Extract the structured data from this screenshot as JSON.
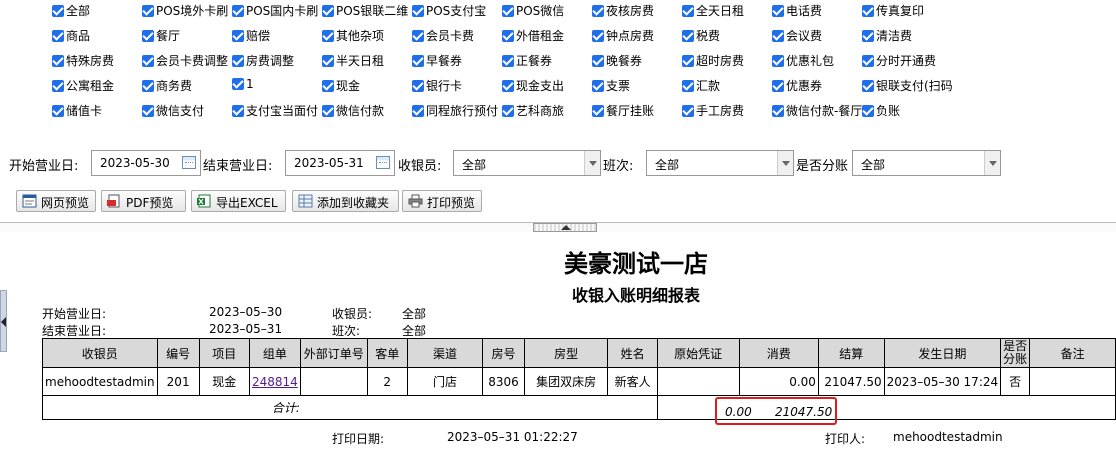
{
  "filters": {
    "checkbox_rows": [
      [
        "全部",
        "POS境外卡刷",
        "POS国内卡刷",
        "POS银联二维",
        "POS支付宝",
        "POS微信",
        "夜核房费",
        "全天日租",
        "电话费",
        "传真复印"
      ],
      [
        "商品",
        "餐厅",
        "赔偿",
        "其他杂项",
        "会员卡费",
        "外借租金",
        "钟点房费",
        "税费",
        "会议费",
        "清洁费"
      ],
      [
        "特殊房费",
        "会员卡费调整",
        "房费调整",
        "半天日租",
        "早餐券",
        "正餐券",
        "晚餐券",
        "超时房费",
        "优惠礼包",
        "分时开通费"
      ],
      [
        "公寓租金",
        "商务费",
        "1",
        "现金",
        "银行卡",
        "现金支出",
        "支票",
        "汇款",
        "优惠券",
        "银联支付(扫码"
      ],
      [
        "储值卡",
        "微信支付",
        "支付宝当面付",
        "微信付款",
        "同程旅行预付",
        "艺科商旅",
        "餐厅挂账",
        "手工房费",
        "微信付款-餐厅",
        "负账"
      ]
    ],
    "start_label": "开始营业日:",
    "start_value": "2023-05-30",
    "end_label": "结束营业日:",
    "end_value": "2023-05-31",
    "cashier_label": "收银员:",
    "cashier_value": "全部",
    "shift_label": "班次:",
    "shift_value": "全部",
    "split_label": "是否分账",
    "split_value": "全部"
  },
  "toolbar": {
    "web_preview": "网页预览",
    "pdf_preview": "PDF预览",
    "export_excel": "导出EXCEL",
    "add_favorite": "添加到收藏夹",
    "print_preview": "打印预览"
  },
  "report": {
    "title": "美豪测试一店",
    "subtitle": "收银入账明细报表",
    "start_label": "开始营业日:",
    "start_value": "2023–05–30",
    "end_label": "结束营业日:",
    "end_value": "2023–05–31",
    "cashier_label": "收银员:",
    "cashier_value": "全部",
    "shift_label": "班次:",
    "shift_value": "全部",
    "columns": [
      "收银员",
      "编号",
      "项目",
      "组单",
      "外部订单号",
      "客单",
      "渠道",
      "房号",
      "房型",
      "姓名",
      "原始凭证",
      "消费",
      "结算",
      "发生日期",
      "是否分账",
      "备注"
    ],
    "row": {
      "cashier": "mehoodtestadmin",
      "no": "201",
      "item": "现金",
      "group": "248814",
      "ext_order": "",
      "guest": "2",
      "channel": "门店",
      "room": "8306",
      "room_type": "集团双床房",
      "name": "新客人",
      "voucher": "",
      "consume": "0.00",
      "settle": "21047.50",
      "date": "2023–05–30 17:24",
      "split": "否",
      "remark": ""
    },
    "total_label": "合计:",
    "total_consume": "0.00",
    "total_settle": "21047.50",
    "print_date_label": "打印日期:",
    "print_date_value": "2023–05–31 01:22:27",
    "printer_label": "打印人:",
    "printer_value": "mehoodtestadmin"
  },
  "colors": {
    "checkbox": "#1f6feb",
    "highlight": "#e01b1b",
    "link": "#551a8b"
  }
}
